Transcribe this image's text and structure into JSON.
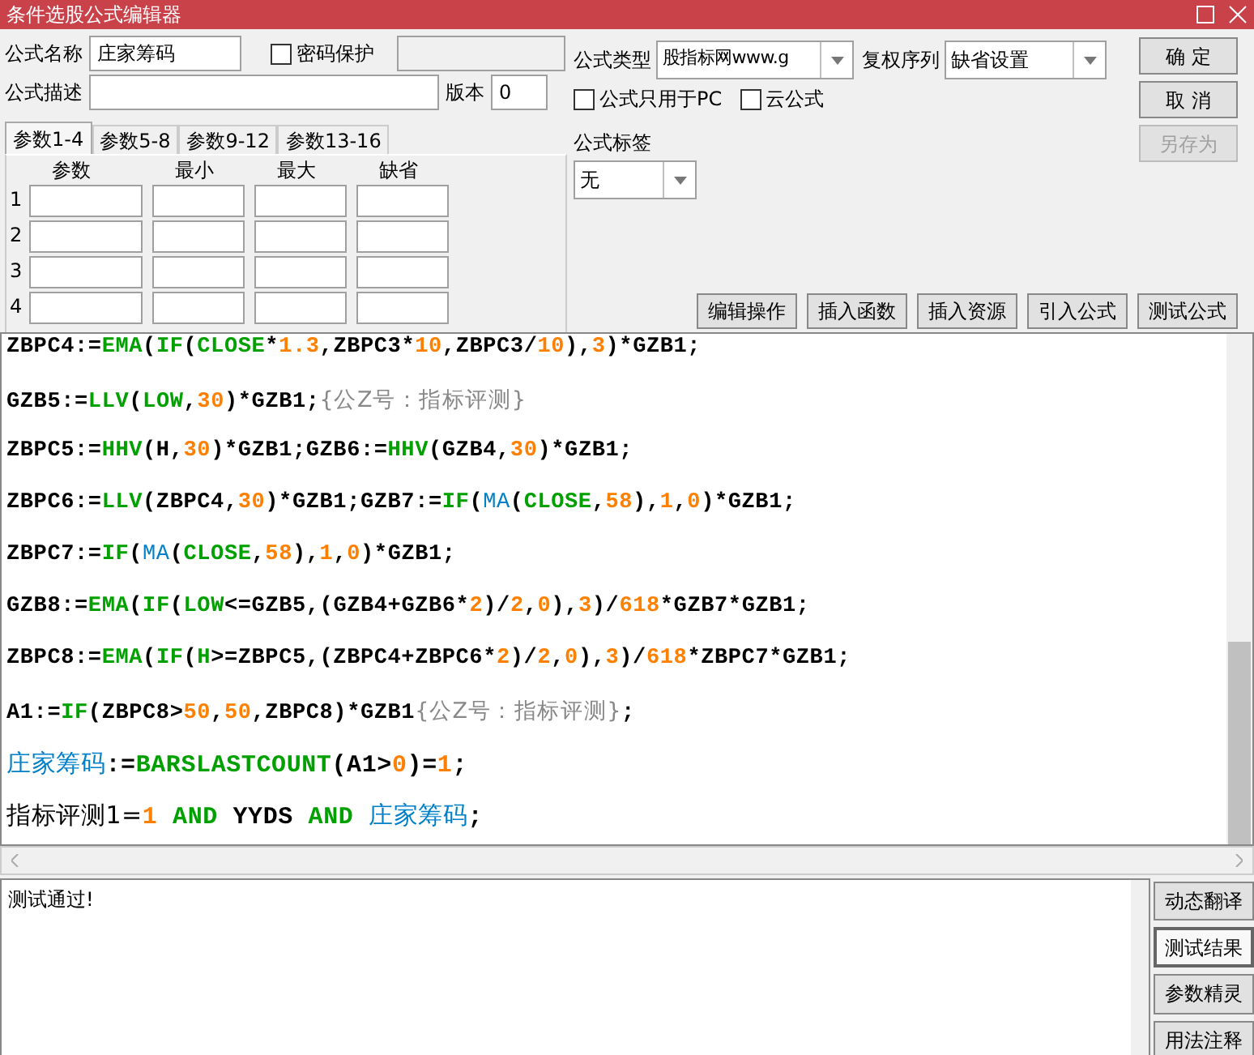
{
  "window": {
    "title": "条件选股公式编辑器"
  },
  "form": {
    "name_label": "公式名称",
    "name_value": "庄家筹码",
    "password": {
      "label": "密码保护",
      "checked": false
    },
    "desc_label": "公式描述",
    "version_label": "版本",
    "version_value": "0",
    "type_label": "公式类型",
    "type_value": "股指标网www.g",
    "adjust_label": "复权序列",
    "adjust_value": "缺省设置",
    "pc_only": {
      "label": "公式只用于PC",
      "checked": false
    },
    "cloud": {
      "label": "云公式",
      "checked": false
    },
    "tag_label": "公式标签",
    "tag_value": "无"
  },
  "dialog_buttons": [
    {
      "label": "确 定",
      "disabled": false
    },
    {
      "label": "取 消",
      "disabled": false
    },
    {
      "label": "另存为",
      "disabled": true
    }
  ],
  "param_tabs": [
    {
      "label": "参数1-4",
      "selected": true
    },
    {
      "label": "参数5-8",
      "selected": false
    },
    {
      "label": "参数9-12",
      "selected": false
    },
    {
      "label": "参数13-16",
      "selected": false
    }
  ],
  "param_columns": [
    "参数",
    "最小",
    "最大",
    "缺省"
  ],
  "param_rows": [
    "1",
    "2",
    "3",
    "4"
  ],
  "toolbar": [
    "编辑操作",
    "插入函数",
    "插入资源",
    "引入公式",
    "测试公式"
  ],
  "code_lines": [
    [
      {
        "kind": "plain",
        "text": "ZBPC4:="
      },
      {
        "kind": "func",
        "text": "EMA"
      },
      {
        "kind": "plain",
        "text": "("
      },
      {
        "kind": "func",
        "text": "IF"
      },
      {
        "kind": "plain",
        "text": "("
      },
      {
        "kind": "func",
        "text": "CLOSE"
      },
      {
        "kind": "plain",
        "text": "*"
      },
      {
        "kind": "num",
        "text": "1.3"
      },
      {
        "kind": "plain",
        "text": ",ZBPC3*"
      },
      {
        "kind": "num",
        "text": "10"
      },
      {
        "kind": "plain",
        "text": ",ZBPC3/"
      },
      {
        "kind": "num",
        "text": "10"
      },
      {
        "kind": "plain",
        "text": "),"
      },
      {
        "kind": "num",
        "text": "3"
      },
      {
        "kind": "plain",
        "text": ")*GZB1;"
      }
    ],
    [
      {
        "kind": "plain",
        "text": "GZB5:="
      },
      {
        "kind": "func",
        "text": "LLV"
      },
      {
        "kind": "plain",
        "text": "("
      },
      {
        "kind": "func",
        "text": "LOW"
      },
      {
        "kind": "plain",
        "text": ","
      },
      {
        "kind": "num",
        "text": "30"
      },
      {
        "kind": "plain",
        "text": ")*GZB1;"
      },
      {
        "kind": "comment",
        "text": "{公Z号：指标评测}"
      }
    ],
    [
      {
        "kind": "plain",
        "text": "ZBPC5:="
      },
      {
        "kind": "func",
        "text": "HHV"
      },
      {
        "kind": "plain",
        "text": "(H,"
      },
      {
        "kind": "num",
        "text": "30"
      },
      {
        "kind": "plain",
        "text": ")*GZB1;GZB6:="
      },
      {
        "kind": "func",
        "text": "HHV"
      },
      {
        "kind": "plain",
        "text": "(GZB4,"
      },
      {
        "kind": "num",
        "text": "30"
      },
      {
        "kind": "plain",
        "text": ")*GZB1;"
      }
    ],
    [
      {
        "kind": "plain",
        "text": "ZBPC6:="
      },
      {
        "kind": "func",
        "text": "LLV"
      },
      {
        "kind": "plain",
        "text": "(ZBPC4,"
      },
      {
        "kind": "num",
        "text": "30"
      },
      {
        "kind": "plain",
        "text": ")*GZB1;GZB7:="
      },
      {
        "kind": "func",
        "text": "IF"
      },
      {
        "kind": "plain",
        "text": "("
      },
      {
        "kind": "name",
        "text": "MA"
      },
      {
        "kind": "plain",
        "text": "("
      },
      {
        "kind": "func",
        "text": "CLOSE"
      },
      {
        "kind": "plain",
        "text": ","
      },
      {
        "kind": "num",
        "text": "58"
      },
      {
        "kind": "plain",
        "text": "),"
      },
      {
        "kind": "num",
        "text": "1"
      },
      {
        "kind": "plain",
        "text": ","
      },
      {
        "kind": "num",
        "text": "0"
      },
      {
        "kind": "plain",
        "text": ")*GZB1;"
      }
    ],
    [
      {
        "kind": "plain",
        "text": "ZBPC7:="
      },
      {
        "kind": "func",
        "text": "IF"
      },
      {
        "kind": "plain",
        "text": "("
      },
      {
        "kind": "name",
        "text": "MA"
      },
      {
        "kind": "plain",
        "text": "("
      },
      {
        "kind": "func",
        "text": "CLOSE"
      },
      {
        "kind": "plain",
        "text": ","
      },
      {
        "kind": "num",
        "text": "58"
      },
      {
        "kind": "plain",
        "text": "),"
      },
      {
        "kind": "num",
        "text": "1"
      },
      {
        "kind": "plain",
        "text": ","
      },
      {
        "kind": "num",
        "text": "0"
      },
      {
        "kind": "plain",
        "text": ")*GZB1;"
      }
    ],
    [
      {
        "kind": "plain",
        "text": "GZB8:="
      },
      {
        "kind": "func",
        "text": "EMA"
      },
      {
        "kind": "plain",
        "text": "("
      },
      {
        "kind": "func",
        "text": "IF"
      },
      {
        "kind": "plain",
        "text": "("
      },
      {
        "kind": "func",
        "text": "LOW"
      },
      {
        "kind": "plain",
        "text": "<=GZB5,(GZB4+GZB6*"
      },
      {
        "kind": "num",
        "text": "2"
      },
      {
        "kind": "plain",
        "text": ")/"
      },
      {
        "kind": "num",
        "text": "2"
      },
      {
        "kind": "plain",
        "text": ","
      },
      {
        "kind": "num",
        "text": "0"
      },
      {
        "kind": "plain",
        "text": "),"
      },
      {
        "kind": "num",
        "text": "3"
      },
      {
        "kind": "plain",
        "text": ")/"
      },
      {
        "kind": "num",
        "text": "618"
      },
      {
        "kind": "plain",
        "text": "*GZB7*GZB1;"
      }
    ],
    [
      {
        "kind": "plain",
        "text": "ZBPC8:="
      },
      {
        "kind": "func",
        "text": "EMA"
      },
      {
        "kind": "plain",
        "text": "("
      },
      {
        "kind": "func",
        "text": "IF"
      },
      {
        "kind": "plain",
        "text": "("
      },
      {
        "kind": "func",
        "text": "H"
      },
      {
        "kind": "plain",
        "text": ">=ZBPC5,(ZBPC4+ZBPC6*"
      },
      {
        "kind": "num",
        "text": "2"
      },
      {
        "kind": "plain",
        "text": ")/"
      },
      {
        "kind": "num",
        "text": "2"
      },
      {
        "kind": "plain",
        "text": ","
      },
      {
        "kind": "num",
        "text": "0"
      },
      {
        "kind": "plain",
        "text": "),"
      },
      {
        "kind": "num",
        "text": "3"
      },
      {
        "kind": "plain",
        "text": ")/"
      },
      {
        "kind": "num",
        "text": "618"
      },
      {
        "kind": "plain",
        "text": "*ZBPC7*GZB1;"
      }
    ],
    [
      {
        "kind": "plain",
        "text": "A1:="
      },
      {
        "kind": "func",
        "text": "IF"
      },
      {
        "kind": "plain",
        "text": "(ZBPC8>"
      },
      {
        "kind": "num",
        "text": "50"
      },
      {
        "kind": "plain",
        "text": ","
      },
      {
        "kind": "num",
        "text": "50"
      },
      {
        "kind": "plain",
        "text": ",ZBPC8)*GZB1"
      },
      {
        "kind": "comment",
        "text": "{公Z号：指标评测}"
      },
      {
        "kind": "plain",
        "text": ";"
      }
    ],
    [
      {
        "kind": "name",
        "text": "庄家筹码"
      },
      {
        "kind": "plain",
        "text": ":="
      },
      {
        "kind": "func",
        "text": "BARSLASTCOUNT"
      },
      {
        "kind": "plain",
        "text": "(A1>"
      },
      {
        "kind": "num",
        "text": "0"
      },
      {
        "kind": "plain",
        "text": ")="
      },
      {
        "kind": "num",
        "text": "1"
      },
      {
        "kind": "plain",
        "text": ";"
      }
    ],
    [
      {
        "kind": "plain",
        "text": "指标评测1="
      },
      {
        "kind": "num",
        "text": "1"
      },
      {
        "kind": "func",
        "text": " AND"
      },
      {
        "kind": "plain",
        "text": " YYDS "
      },
      {
        "kind": "func",
        "text": "AND "
      },
      {
        "kind": "name",
        "text": "庄家筹码"
      },
      {
        "kind": "plain",
        "text": ";"
      }
    ]
  ],
  "output": {
    "text": "测试通过!"
  },
  "side_buttons": [
    {
      "label": "动态翻译",
      "selected": false
    },
    {
      "label": "测试结果",
      "selected": true
    },
    {
      "label": "参数精灵",
      "selected": false
    },
    {
      "label": "用法注释",
      "selected": false
    }
  ]
}
